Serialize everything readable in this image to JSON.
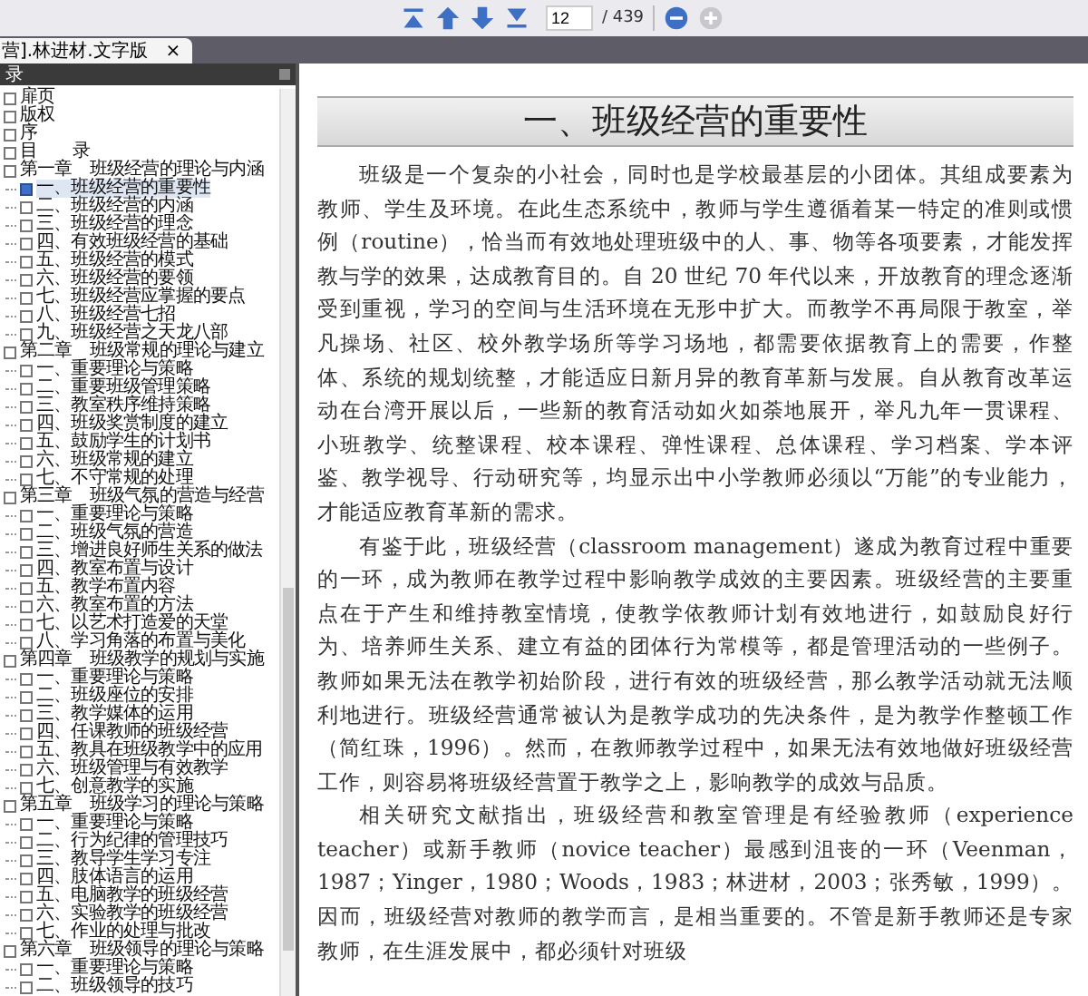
{
  "toolbar": {
    "page_number": "12",
    "page_total": "/ 439",
    "zoom_in_disabled": true
  },
  "tab": {
    "title": "营].林进材.文字版",
    "close": "×"
  },
  "sidebar": {
    "title": "录",
    "items": [
      {
        "label": "扉页",
        "selected": false
      },
      {
        "label": "版权",
        "selected": false
      },
      {
        "label": "序",
        "selected": false
      },
      {
        "label": "目　　录",
        "selected": false
      },
      {
        "label": "第一章　班级经营的理论与内涵",
        "selected": false,
        "children": [
          {
            "label": "一、班级经营的重要性",
            "selected": true
          },
          {
            "label": "二、班级经营的内涵",
            "selected": false
          },
          {
            "label": "三、班级经营的理念",
            "selected": false
          },
          {
            "label": "四、有效班级经营的基础",
            "selected": false
          },
          {
            "label": "五、班级经营的模式",
            "selected": false
          },
          {
            "label": "六、班级经营的要领",
            "selected": false
          },
          {
            "label": "七、班级经营应掌握的要点",
            "selected": false
          },
          {
            "label": "八、班级经营七招",
            "selected": false
          },
          {
            "label": "九、班级经营之天龙八部",
            "selected": false
          }
        ]
      },
      {
        "label": "第二章　班级常规的理论与建立",
        "selected": false,
        "children": [
          {
            "label": "一、重要理论与策略",
            "selected": false
          },
          {
            "label": "二、重要班级管理策略",
            "selected": false
          },
          {
            "label": "三、教室秩序维持策略",
            "selected": false
          },
          {
            "label": "四、班级奖赏制度的建立",
            "selected": false
          },
          {
            "label": "五、鼓励学生的计划书",
            "selected": false
          },
          {
            "label": "六、班级常规的建立",
            "selected": false
          },
          {
            "label": "七、不守常规的处理",
            "selected": false
          }
        ]
      },
      {
        "label": "第三章　班级气氛的营造与经营",
        "selected": false,
        "children": [
          {
            "label": "一、重要理论与策略",
            "selected": false
          },
          {
            "label": "二、班级气氛的营造",
            "selected": false
          },
          {
            "label": "三、增进良好师生关系的做法",
            "selected": false
          },
          {
            "label": "四、教室布置与设计",
            "selected": false
          },
          {
            "label": "五、教学布置内容",
            "selected": false
          },
          {
            "label": "六、教室布置的方法",
            "selected": false
          },
          {
            "label": "七、以艺术打造爱的天堂",
            "selected": false
          },
          {
            "label": "八、学习角落的布置与美化",
            "selected": false
          }
        ]
      },
      {
        "label": "第四章　班级教学的规划与实施",
        "selected": false,
        "children": [
          {
            "label": "一、重要理论与策略",
            "selected": false
          },
          {
            "label": "二、班级座位的安排",
            "selected": false
          },
          {
            "label": "三、教学媒体的运用",
            "selected": false
          },
          {
            "label": "四、任课教师的班级经营",
            "selected": false
          },
          {
            "label": "五、教具在班级教学中的应用",
            "selected": false
          },
          {
            "label": "六、班级管理与有效教学",
            "selected": false
          },
          {
            "label": "七、创意教学的实施",
            "selected": false
          }
        ]
      },
      {
        "label": "第五章　班级学习的理论与策略",
        "selected": false,
        "children": [
          {
            "label": "一、重要理论与策略",
            "selected": false
          },
          {
            "label": "二、行为纪律的管理技巧",
            "selected": false
          },
          {
            "label": "三、教导学生学习专注",
            "selected": false
          },
          {
            "label": "四、肢体语言的运用",
            "selected": false
          },
          {
            "label": "五、电脑教学的班级经营",
            "selected": false
          },
          {
            "label": "六、实验教学的班级经营",
            "selected": false
          },
          {
            "label": "七、作业的处理与批改",
            "selected": false
          }
        ]
      },
      {
        "label": "第六章　班级领导的理论与策略",
        "selected": false,
        "children": [
          {
            "label": "一、重要理论与策略",
            "selected": false
          },
          {
            "label": "二、班级领导的技巧",
            "selected": false
          }
        ]
      }
    ]
  },
  "page": {
    "heading": "一、班级经营的重要性",
    "paragraphs": [
      "班级是一个复杂的小社会，同时也是学校最基层的小团体。其组成要素为教师、学生及环境。在此生态系统中，教师与学生遵循着某一特定的准则或惯例（routine），恰当而有效地处理班级中的人、事、物等各项要素，才能发挥教与学的效果，达成教育目的。自 20 世纪 70 年代以来，开放教育的理念逐渐受到重视，学习的空间与生活环境在无形中扩大。而教学不再局限于教室，举凡操场、社区、校外教学场所等学习场地，都需要依据教育上的需要，作整体、系统的规划统整，才能适应日新月异的教育革新与发展。自从教育改革运动在台湾开展以后，一些新的教育活动如火如荼地展开，举凡九年一贯课程、小班教学、统整课程、校本课程、弹性课程、总体课程、学习档案、学本评鉴、教学视导、行动研究等，均显示出中小学教师必须以“万能”的专业能力，才能适应教育革新的需求。",
      "有鉴于此，班级经营（classroom management）遂成为教育过程中重要的一环，成为教师在教学过程中影响教学成效的主要因素。班级经营的主要重点在于产生和维持教室情境，使教学依教师计划有效地进行，如鼓励良好行为、培养师生关系、建立有益的团体行为常模等，都是管理活动的一些例子。教师如果无法在教学初始阶段，进行有效的班级经营，那么教学活动就无法顺利地进行。班级经营通常被认为是教学成功的先决条件，是为教学作整顿工作（简红珠，1996）。然而，在教师教学过程中，如果无法有效地做好班级经营工作，则容易将班级经营置于教学之上，影响教学的成效与品质。",
      "相关研究文献指出，班级经营和教室管理是有经验教师（experience teacher）或新手教师（novice teacher）最感到沮丧的一环（Veenman，1987；Yinger，1980；Woods，1983；林进材，2003；张秀敏，1999）。因而，班级经营对教师的教学而言，是相当重要的。不管是新手教师还是专家教师，在生涯发展中，都必须针对班级"
    ]
  }
}
